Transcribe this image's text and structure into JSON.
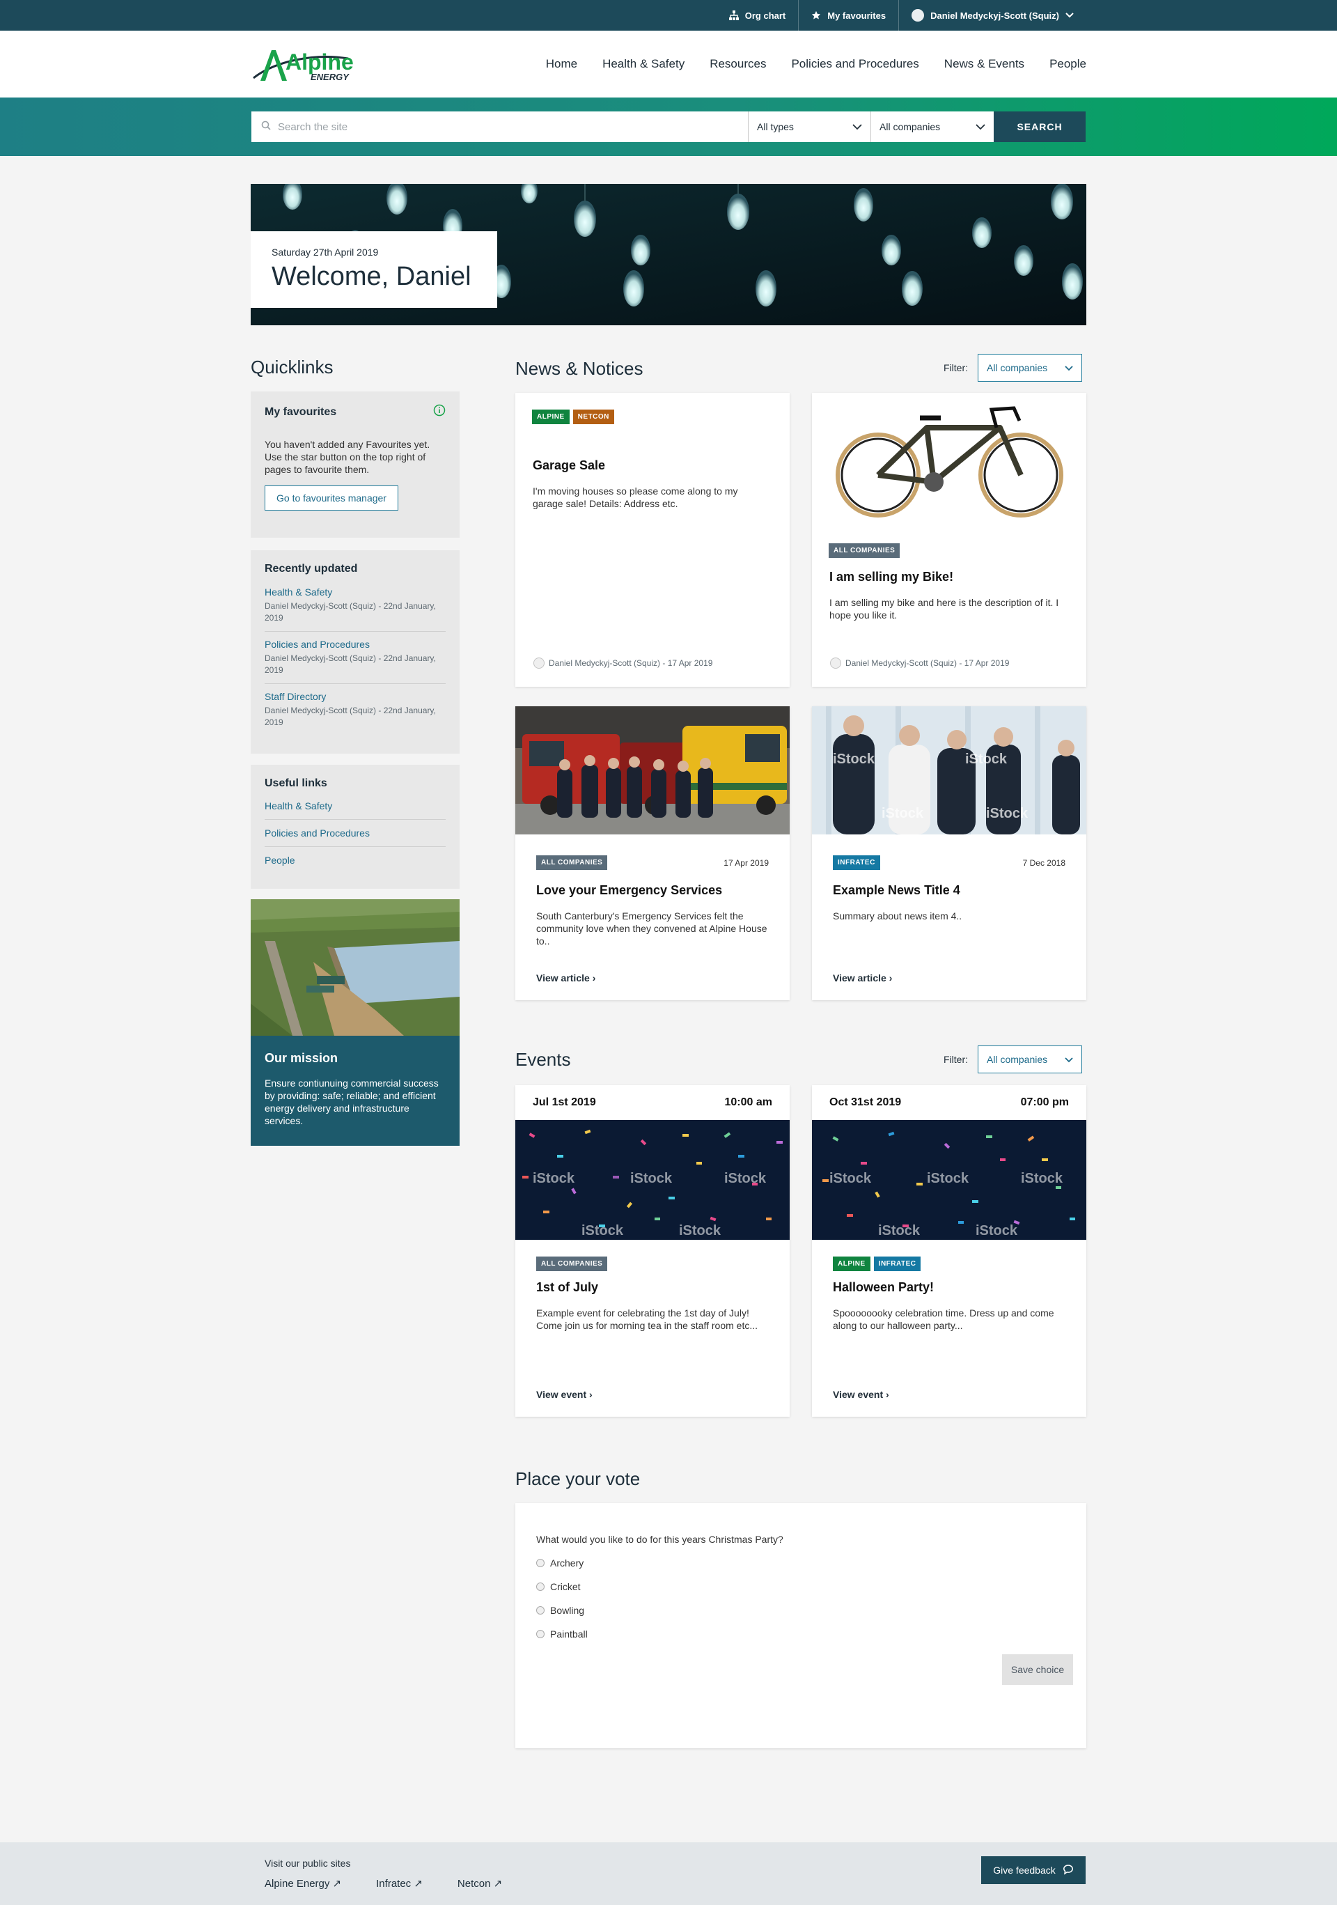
{
  "utility_bar": {
    "org_chart": "Org chart",
    "my_favourites": "My favourites",
    "user_name": "Daniel Medyckyj-Scott (Squiz)"
  },
  "brand": {
    "name": "Alpine",
    "sub": "ENERGY"
  },
  "nav": {
    "items": [
      "Home",
      "Health & Safety",
      "Resources",
      "Policies and Procedures",
      "News & Events",
      "People"
    ]
  },
  "search": {
    "placeholder": "Search the site",
    "type_select": "All types",
    "company_select": "All companies",
    "button": "SEARCH"
  },
  "hero": {
    "date": "Saturday 27th April 2019",
    "welcome": "Welcome, Daniel"
  },
  "quicklinks": {
    "title": "Quicklinks",
    "favourites": {
      "title": "My favourites",
      "text": "You haven't added any Favourites yet. Use the star button on the top right of pages to favourite them.",
      "button": "Go to favourites manager"
    },
    "recently_updated": {
      "title": "Recently updated",
      "items": [
        {
          "link": "Health & Safety",
          "meta": "Daniel Medyckyj-Scott (Squiz) - 22nd January, 2019"
        },
        {
          "link": "Policies and Procedures",
          "meta": "Daniel Medyckyj-Scott (Squiz) - 22nd January, 2019"
        },
        {
          "link": "Staff Directory",
          "meta": "Daniel Medyckyj-Scott (Squiz) - 22nd January, 2019"
        }
      ]
    },
    "useful_links": {
      "title": "Useful links",
      "items": [
        "Health & Safety",
        "Policies and Procedures",
        "People"
      ]
    },
    "mission": {
      "title": "Our mission",
      "text": "Ensure contiunuing commercial success by providing: safe; reliable; and efficient energy delivery and infrastructure services."
    }
  },
  "news": {
    "title": "News & Notices",
    "filter_label": "Filter:",
    "filter_value": "All companies",
    "cards": [
      {
        "tags": [
          "ALPINE",
          "NETCON"
        ],
        "title": "Garage Sale",
        "summary": "I'm moving houses so please come along to my garage sale! Details: Address etc.",
        "author": "Daniel Medyckyj-Scott (Squiz) - 17 Apr 2019"
      },
      {
        "tags": [
          "ALL COMPANIES"
        ],
        "title": "I am selling my Bike!",
        "summary": "I am selling my bike and here is the description of it. I hope you like it.",
        "author": "Daniel Medyckyj-Scott (Squiz) - 17 Apr 2019"
      },
      {
        "tags": [
          "ALL COMPANIES"
        ],
        "date": "17 Apr 2019",
        "title": "Love your Emergency Services",
        "summary": "South Canterbury's Emergency Services felt the community love when they convened at Alpine House to..",
        "link": "View article"
      },
      {
        "tags": [
          "INFRATEC"
        ],
        "date": "7 Dec 2018",
        "title": "Example News Title 4",
        "summary": "Summary about news item 4..",
        "link": "View article"
      }
    ]
  },
  "events": {
    "title": "Events",
    "filter_label": "Filter:",
    "filter_value": "All companies",
    "cards": [
      {
        "date": "Jul 1st 2019",
        "time": "10:00 am",
        "tags": [
          "ALL COMPANIES"
        ],
        "title": "1st of July",
        "summary": "Example event for celebrating the 1st day of July! Come join us for morning tea in the staff room etc...",
        "link": "View event"
      },
      {
        "date": "Oct 31st 2019",
        "time": "07:00 pm",
        "tags": [
          "ALPINE",
          "INFRATEC"
        ],
        "title": "Halloween Party!",
        "summary": "Spoooooooky celebration time. Dress up and come along to our halloween party...",
        "link": "View event"
      }
    ]
  },
  "vote": {
    "title": "Place your vote",
    "question": "What would you like to do for this years Christmas Party?",
    "options": [
      "Archery",
      "Cricket",
      "Bowling",
      "Paintball"
    ],
    "button": "Save choice"
  },
  "footer": {
    "label": "Visit our public sites",
    "links": [
      "Alpine Energy ↗",
      "Infratec ↗",
      "Netcon ↗"
    ],
    "feedback": "Give feedback"
  },
  "watermark": "iStock",
  "colors": {
    "primary": "#1d4a5a",
    "accent_green": "#00a85a",
    "link": "#1d6a8a"
  }
}
